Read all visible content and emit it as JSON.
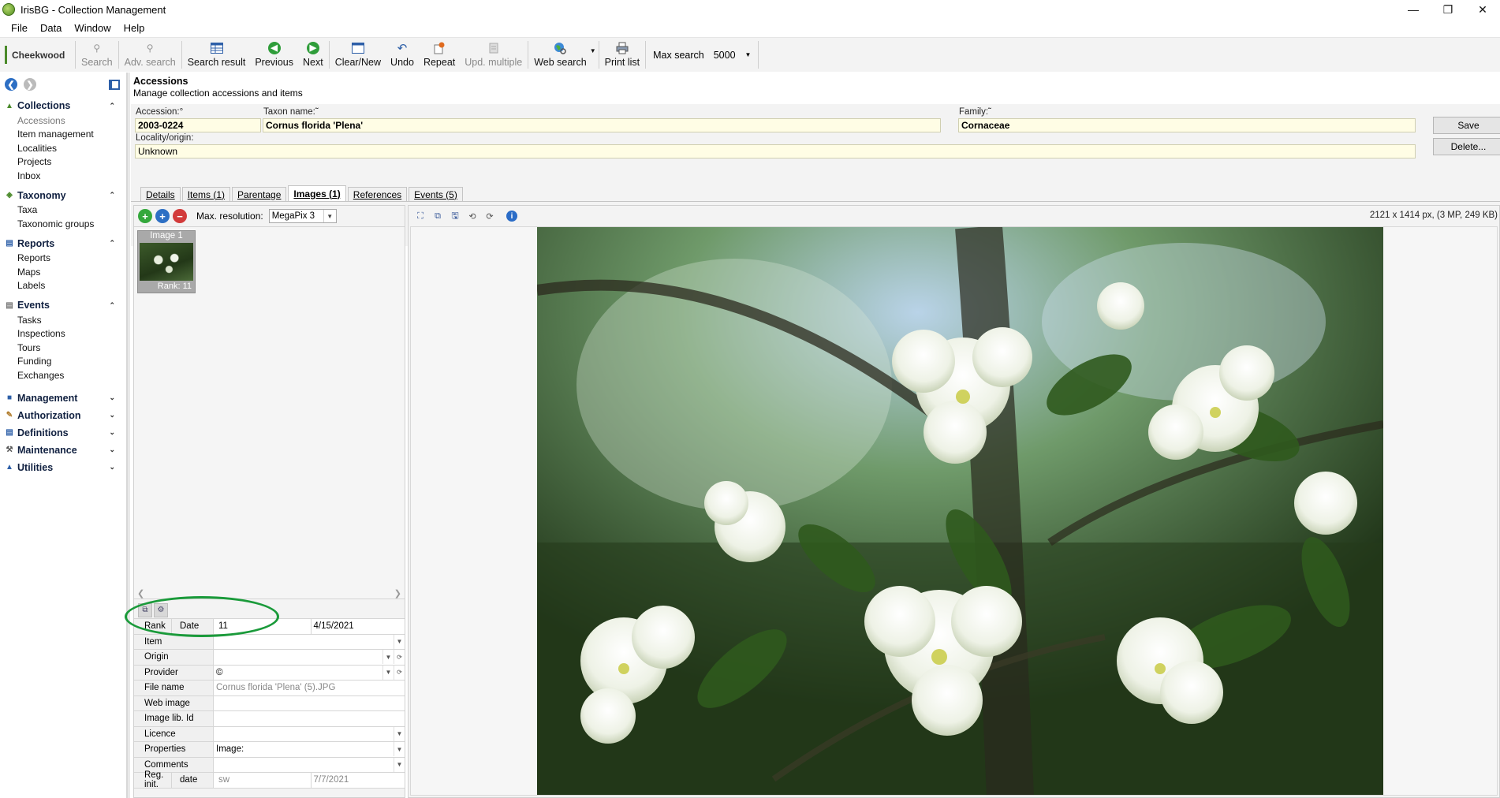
{
  "window": {
    "title": "IrisBG - Collection Management",
    "controls": [
      "—",
      "❐",
      "✕"
    ]
  },
  "menu": [
    "File",
    "Data",
    "Window",
    "Help"
  ],
  "toolbar": {
    "site": "Cheekwood",
    "buttons": [
      {
        "id": "search",
        "label": "Search",
        "enabled": false
      },
      {
        "id": "adv",
        "label": "Adv. search",
        "enabled": false
      },
      {
        "id": "result",
        "label": "Search result",
        "enabled": true
      },
      {
        "id": "prev",
        "label": "Previous",
        "enabled": true
      },
      {
        "id": "next",
        "label": "Next",
        "enabled": true
      },
      {
        "id": "clear",
        "label": "Clear/New",
        "enabled": true
      },
      {
        "id": "undo",
        "label": "Undo",
        "enabled": true
      },
      {
        "id": "repeat",
        "label": "Repeat",
        "enabled": true
      },
      {
        "id": "updmulti",
        "label": "Upd. multiple",
        "enabled": false
      },
      {
        "id": "websearch",
        "label": "Web search",
        "enabled": true
      },
      {
        "id": "print",
        "label": "Print list",
        "enabled": true
      }
    ],
    "max_search_label": "Max search",
    "max_search_value": "5000"
  },
  "sidebar": {
    "groups": [
      {
        "label": "Collections",
        "expanded": true,
        "items": [
          "Accessions",
          "Item management",
          "Localities",
          "Projects",
          "Inbox"
        ]
      },
      {
        "label": "Taxonomy",
        "expanded": true,
        "items": [
          "Taxa",
          "Taxonomic groups"
        ]
      },
      {
        "label": "Reports",
        "expanded": true,
        "items": [
          "Reports",
          "Maps",
          "Labels"
        ]
      },
      {
        "label": "Events",
        "expanded": true,
        "items": [
          "Tasks",
          "Inspections",
          "Tours",
          "Funding",
          "Exchanges"
        ]
      },
      {
        "label": "Management",
        "expanded": false,
        "items": []
      },
      {
        "label": "Authorization",
        "expanded": false,
        "items": []
      },
      {
        "label": "Definitions",
        "expanded": false,
        "items": []
      },
      {
        "label": "Maintenance",
        "expanded": false,
        "items": []
      },
      {
        "label": "Utilities",
        "expanded": false,
        "items": []
      }
    ],
    "active_item": "Accessions"
  },
  "page": {
    "title": "Accessions",
    "subtitle": "Manage collection accessions and items"
  },
  "form": {
    "accession_label": "Accession:°",
    "accession_value": "2003-0224",
    "taxon_label": "Taxon name:˜",
    "taxon_value": "Cornus florida 'Plena'",
    "family_label": "Family:˜",
    "family_value": "Cornaceae",
    "locality_label": "Locality/origin:",
    "locality_value": "Unknown",
    "save_label": "Save",
    "delete_label": "Delete..."
  },
  "tabs": [
    {
      "label": "Details",
      "active": false
    },
    {
      "label": "Items (1)",
      "active": false
    },
    {
      "label": "Parentage",
      "active": false
    },
    {
      "label": "Images (1)",
      "active": true
    },
    {
      "label": "References",
      "active": false
    },
    {
      "label": "Events (5)",
      "active": false
    }
  ],
  "images": {
    "max_resolution_label": "Max. resolution:",
    "max_resolution_value": "MegaPix 3",
    "thumb": {
      "title": "Image 1",
      "rank": "Rank: 11"
    },
    "dims": "2121 x 1414 px, (3 MP, 249 KB)"
  },
  "properties": {
    "rank_label": "Rank",
    "date_label": "Date",
    "rank_value": "11",
    "date_value": "4/15/2021",
    "item_label": "Item",
    "item_value": "",
    "origin_label": "Origin",
    "origin_value": "",
    "provider_label": "Provider",
    "provider_value": "©",
    "file_label": "File name",
    "file_value": "Cornus florida 'Plena' (5).JPG",
    "web_label": "Web image",
    "web_value": "",
    "lib_label": "Image lib. Id",
    "lib_value": "",
    "licence_label": "Licence",
    "licence_value": "",
    "properties_label": "Properties",
    "properties_value": "Image:",
    "comments_label": "Comments",
    "comments_value": "",
    "reg_label": "Reg. init.",
    "reg_date_label": "date",
    "reg_init_value": "sw",
    "reg_date_value": "7/7/2021"
  },
  "colors": {
    "field_bg": "#fffde5",
    "annotation": "#1a9a3a"
  }
}
